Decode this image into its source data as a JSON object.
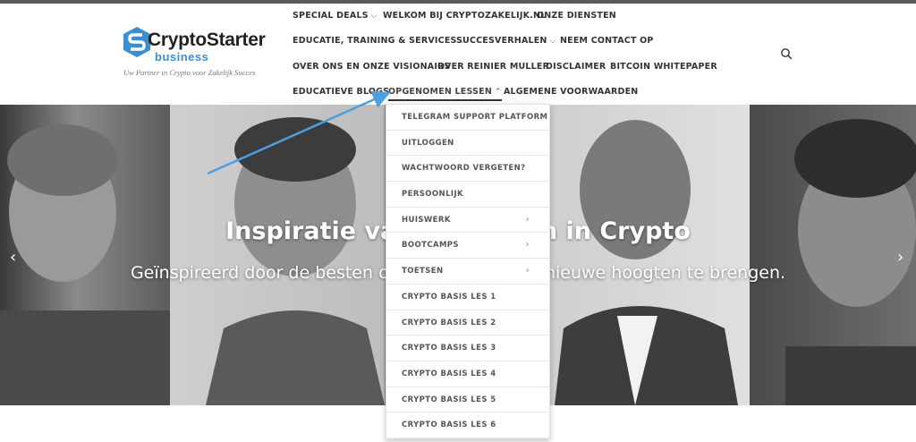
{
  "logo": {
    "brand": "CryptoStarter",
    "sub": "business",
    "tagline": "Uw Partner in Crypto voor Zakelijk Succes"
  },
  "nav": {
    "row1": [
      {
        "label": "SPECIAL DEALS",
        "has_dropdown": true
      },
      {
        "label": "WELKOM BIJ CRYPTOZAKELIJK.NL",
        "has_dropdown": false
      },
      {
        "label": "ONZE DIENSTEN",
        "has_dropdown": false
      }
    ],
    "row2": [
      {
        "label": "EDUCATIE, TRAINING & SERVICES",
        "has_dropdown": true
      },
      {
        "label": "SUCCESVERHALEN",
        "has_dropdown": true
      },
      {
        "label": "NEEM CONTACT OP",
        "has_dropdown": false
      }
    ],
    "row3": [
      {
        "label": "OVER ONS EN ONZE VISIONAIRS",
        "has_dropdown": false
      },
      {
        "label": "OVER REINIER MULLER",
        "has_dropdown": false
      },
      {
        "label": "DISCLAIMER",
        "has_dropdown": false
      },
      {
        "label": "BITCOIN WHITEPAPER",
        "has_dropdown": false
      }
    ],
    "row4": [
      {
        "label": "EDUCATIEVE BLOGS",
        "has_dropdown": false
      },
      {
        "label": "OPGENOMEN LESSEN",
        "has_dropdown": true,
        "open": true
      },
      {
        "label": "ALGEMENE VOORWAARDEN",
        "has_dropdown": false
      }
    ]
  },
  "hero": {
    "title": "Inspiratie van de besten in Crypto",
    "subtitle": "Geïnspireerd door de besten om uw bedrijf naar nieuwe hoogten te brengen."
  },
  "dropdown": {
    "items": [
      {
        "label": "TELEGRAM SUPPORT PLATFORM",
        "has_submenu": false
      },
      {
        "label": "UITLOGGEN",
        "has_submenu": false
      },
      {
        "label": "WACHTWOORD VERGETEN?",
        "has_submenu": false
      },
      {
        "label": "PERSOONLIJK",
        "has_submenu": false
      },
      {
        "label": "HUISWERK",
        "has_submenu": true
      },
      {
        "label": "BOOTCAMPS",
        "has_submenu": true
      },
      {
        "label": "TOETSEN",
        "has_submenu": true
      },
      {
        "label": "CRYPTO BASIS LES 1",
        "has_submenu": false
      },
      {
        "label": "CRYPTO BASIS LES 2",
        "has_submenu": false
      },
      {
        "label": "CRYPTO BASIS LES 3",
        "has_submenu": false
      },
      {
        "label": "CRYPTO BASIS LES 4",
        "has_submenu": false
      },
      {
        "label": "CRYPTO BASIS LES 5",
        "has_submenu": false
      },
      {
        "label": "CRYPTO BASIS LES 6",
        "has_submenu": false
      }
    ]
  },
  "colors": {
    "accent": "#3b8ed0",
    "annotation_arrow": "#4a9fe0",
    "nav_text": "#333333"
  },
  "icons": {
    "search": "search-icon",
    "prev": "chevron-left-icon",
    "next": "chevron-right-icon"
  }
}
